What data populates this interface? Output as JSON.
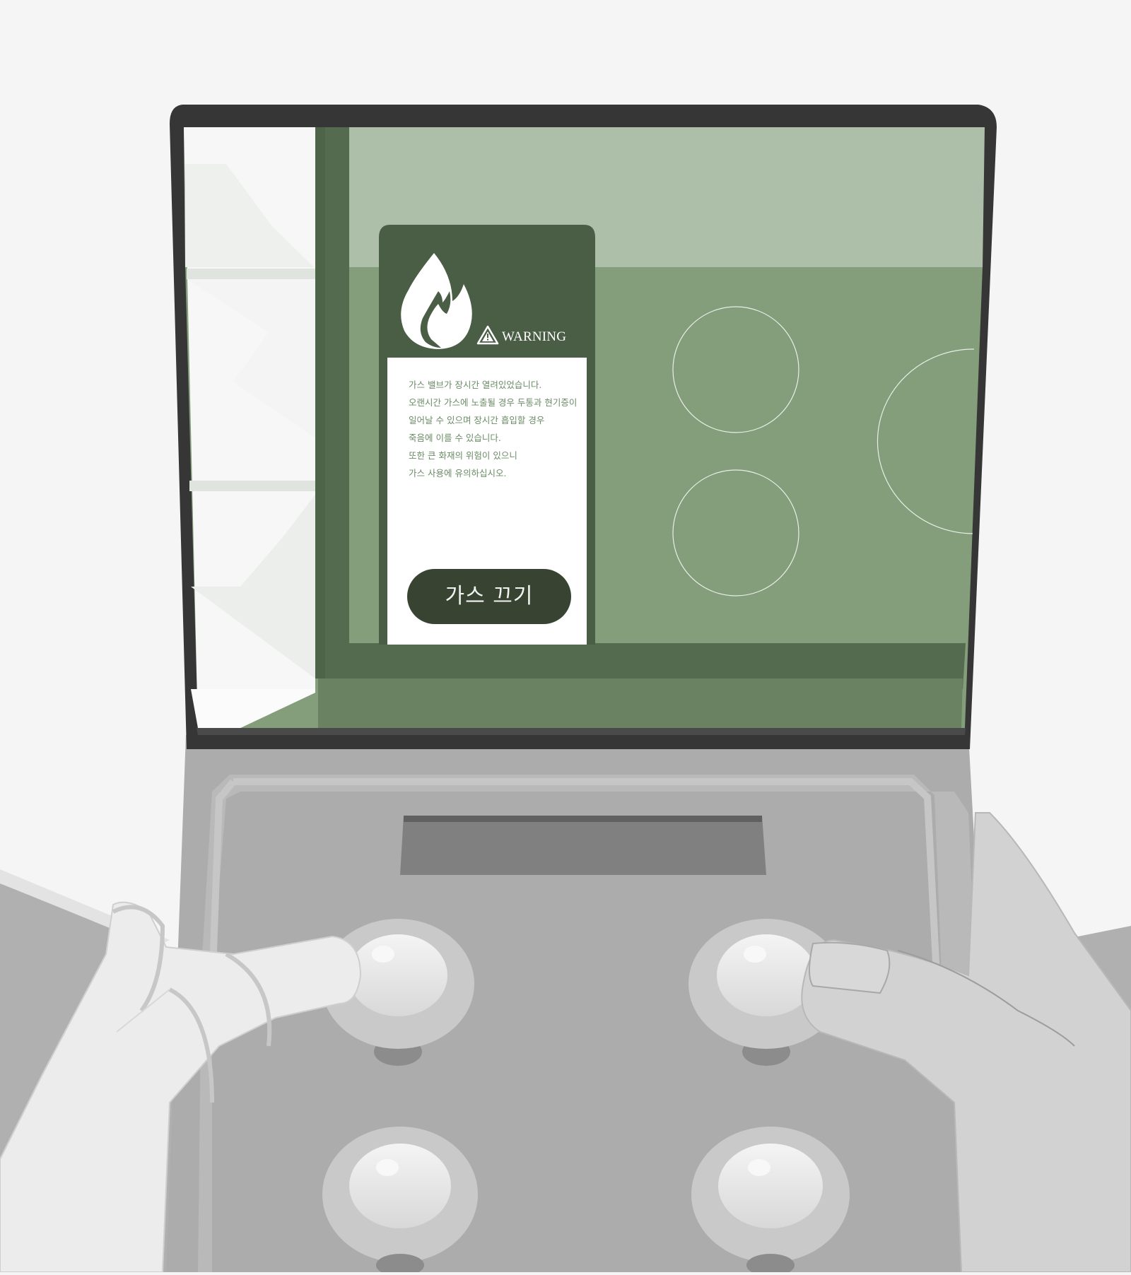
{
  "game": {
    "warning_label": "WARNING",
    "message_lines": [
      "가스 밸브가 장시간 열려있었습니다.",
      "오랜시간 가스에 노출될 경우 두통과 현기증이",
      "일어날 수 있으며 장시간 흡입할 경우",
      "죽음에 이를 수 있습니다.",
      "또한 큰 화재의 위험이 있으니",
      "가스 사용에 유의하십시오."
    ],
    "button_label": "가스 끄기",
    "icons": {
      "flame": "flame-icon",
      "warning": "warning-triangle-icon"
    },
    "burners": [
      "burner-top-left",
      "burner-bottom-left",
      "burner-large-right"
    ],
    "controller_buttons": [
      "top-left-button",
      "top-right-button",
      "bottom-left-button",
      "bottom-right-button"
    ]
  },
  "colors": {
    "background": "#f5f5f5",
    "screen_sky": "#adbfa9",
    "stovetop": "#849e7b",
    "dark_green_card": "#4a5d45",
    "button_dark": "#384331",
    "device_body": "#acacac",
    "bezel": "#363636",
    "hand": "#ececec",
    "text_green": "#6b8c66"
  }
}
